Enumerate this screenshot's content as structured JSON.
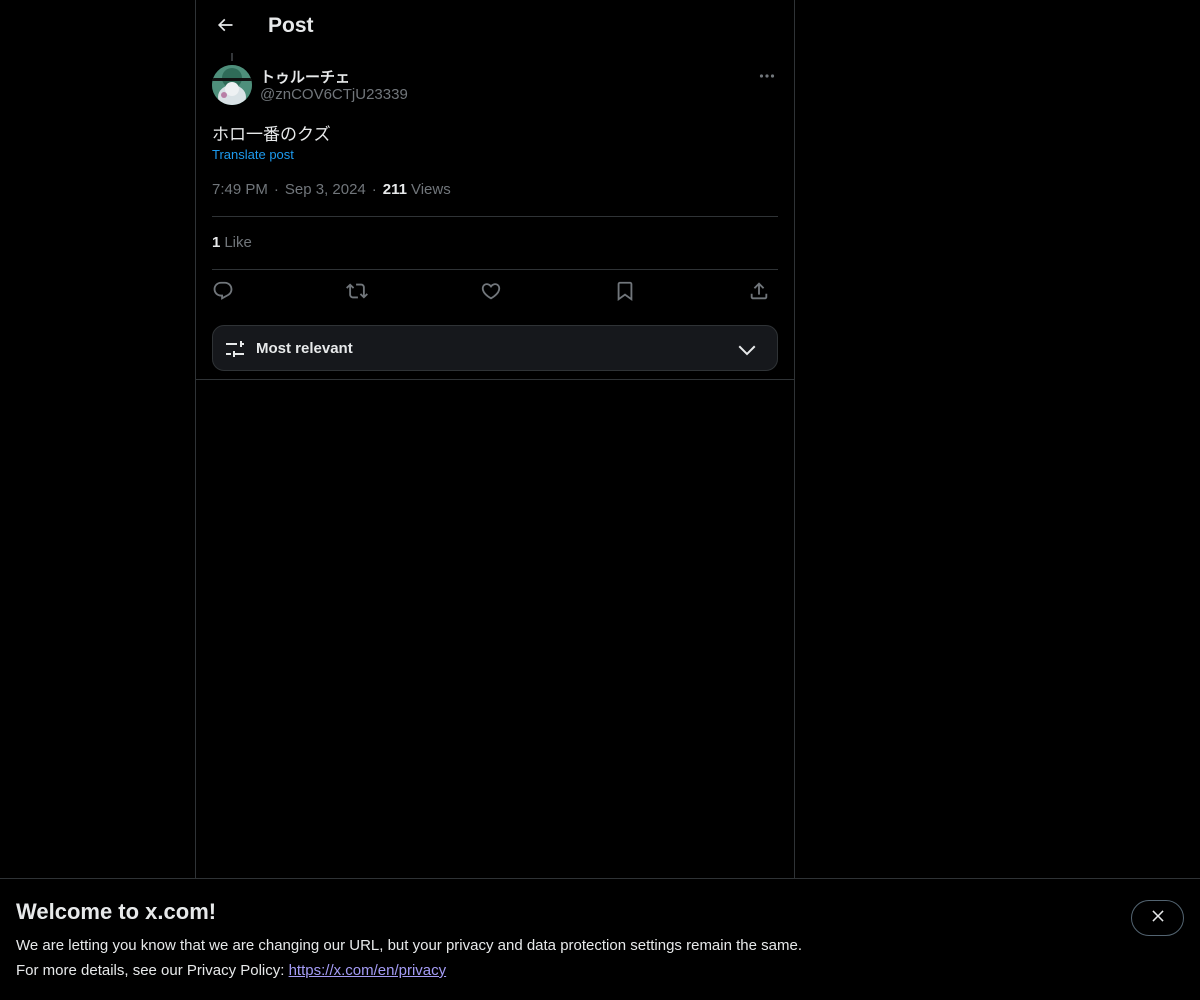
{
  "header": {
    "title": "Post",
    "back_icon": "arrow-left-icon"
  },
  "post": {
    "author": {
      "display_name": "トゥルーチェ",
      "handle": "@znCOV6CTjU23339"
    },
    "text": "ホロ一番のクズ",
    "translate_label": "Translate post",
    "time": "7:49 PM",
    "date": "Sep 3, 2024",
    "separator": "·",
    "views_count": "211",
    "views_label": "Views",
    "likes_count": "1",
    "likes_label": "Like",
    "actions": [
      "reply-icon",
      "repost-icon",
      "like-icon",
      "bookmark-icon",
      "share-icon"
    ]
  },
  "sort": {
    "label": "Most relevant",
    "icon": "sliders-icon",
    "chevron": "chevron-down-icon"
  },
  "banner": {
    "title": "Welcome to x.com!",
    "line1": "We are letting you know that we are changing our URL, but your privacy and data protection settings remain the same.",
    "line2_prefix": "For more details, see our Privacy Policy: ",
    "privacy_link": "https://x.com/en/privacy",
    "close_icon": "close-icon"
  },
  "colors": {
    "background": "#000000",
    "text_primary": "#e7e9ea",
    "text_secondary": "#71767b",
    "accent": "#1d9bf0",
    "link_visited": "#a49cf5",
    "border": "#2f3336"
  }
}
